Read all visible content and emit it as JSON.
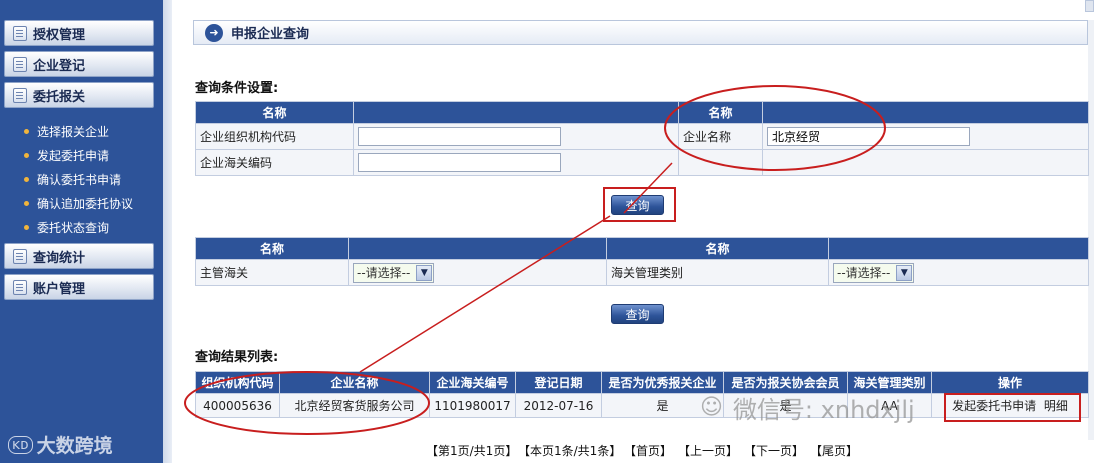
{
  "sidebar": {
    "menus": [
      {
        "label": "授权管理"
      },
      {
        "label": "企业登记"
      },
      {
        "label": "委托报关"
      },
      {
        "label": "查询统计"
      },
      {
        "label": "账户管理"
      }
    ],
    "submenu": [
      {
        "label": "选择报关企业"
      },
      {
        "label": "发起委托申请"
      },
      {
        "label": "确认委托书申请"
      },
      {
        "label": "确认追加委托协议"
      },
      {
        "label": "委托状态查询"
      }
    ],
    "logo_text": "大数跨境",
    "logo_mark": "ĸᴅ"
  },
  "page": {
    "title": "申报企业查询",
    "arrow": "➜"
  },
  "query": {
    "heading": "查询条件设置:",
    "col_name": "名称",
    "org_code_label": "企业组织机构代码",
    "org_code_value": "",
    "company_name_label": "企业名称",
    "company_name_value": "北京经贸",
    "customs_code_label": "企业海关编码",
    "customs_code_value": "",
    "search_button": "查询"
  },
  "query2": {
    "col_name": "名称",
    "customs_label": "主管海关",
    "customs_select": "--请选择--",
    "mgmt_type_label": "海关管理类别",
    "mgmt_type_select": "--请选择--",
    "search_button": "查询"
  },
  "results": {
    "heading": "查询结果列表:",
    "columns": [
      "组织机构代码",
      "企业名称",
      "企业海关编号",
      "登记日期",
      "是否为优秀报关企业",
      "是否为报关协会会员",
      "海关管理类别",
      "操作"
    ],
    "rows": [
      {
        "org_code": "400005636",
        "name": "北京经贸客货服务公司",
        "customs_no": "1101980017",
        "reg_date": "2012-07-16",
        "excellent": "是",
        "member": "是",
        "mgmt_type": "AA",
        "action": "发起委托书申请",
        "detail": "明细"
      }
    ]
  },
  "pager": {
    "page_info": "【第1页/共1页】",
    "record_info": "【本页1条/共1条】",
    "first": "【首页】",
    "prev": "【上一页】",
    "next": "【下一页】",
    "last": "【尾页】"
  },
  "watermark": {
    "icon": "☺",
    "text": "微信号: xnhdxjlj"
  },
  "colors": {
    "sidebar": "#2d5399",
    "header": "#2d5399",
    "annotation": "#c81e1e"
  }
}
